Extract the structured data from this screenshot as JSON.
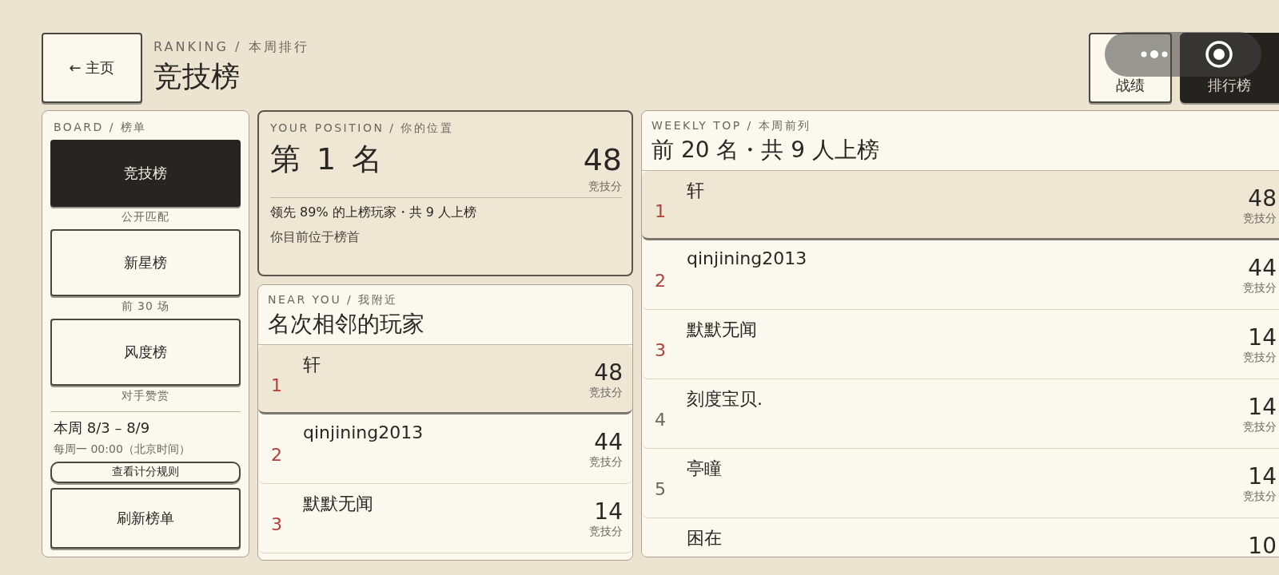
{
  "header": {
    "back_button": "← 主页",
    "eyebrow": "RANKING / 本周排行",
    "title": "竞技榜",
    "tabs": [
      {
        "label": "战绩",
        "selected": false
      },
      {
        "label": "排行榜",
        "selected": true
      }
    ]
  },
  "board": {
    "heading": "BOARD / 榜单",
    "items": [
      {
        "label": "竞技榜",
        "sub": "公开匹配",
        "selected": true
      },
      {
        "label": "新星榜",
        "sub": "前 30 场",
        "selected": false
      },
      {
        "label": "风度榜",
        "sub": "对手赞赏",
        "selected": false
      }
    ],
    "week": "本周 8/3 – 8/9",
    "reset": "每周一 00:00（北京时间）",
    "rules_button": "查看计分规则",
    "refresh_button": "刷新榜单"
  },
  "position": {
    "heading": "YOUR POSITION / 你的位置",
    "rank": "第 1 名",
    "score": "48",
    "score_label": "竞技分",
    "lead": "领先 89% 的上榜玩家・共 9 人上榜",
    "note": "你目前位于榜首"
  },
  "near": {
    "heading": "NEAR YOU / 我附近",
    "title": "名次相邻的玩家",
    "rows": [
      {
        "rank": "1",
        "name": "轩",
        "score": "48",
        "score_label": "竞技分",
        "selected": true,
        "podium": true
      },
      {
        "rank": "2",
        "name": "qinjining2013",
        "score": "44",
        "score_label": "竞技分",
        "selected": false,
        "podium": true
      },
      {
        "rank": "3",
        "name": "默默无闻",
        "score": "14",
        "score_label": "竞技分",
        "selected": false,
        "podium": true
      }
    ]
  },
  "weekly": {
    "heading": "WEEKLY TOP / 本周前列",
    "title": "前 20 名・共 9 人上榜",
    "rows": [
      {
        "rank": "1",
        "name": "轩",
        "score": "48",
        "score_label": "竞技分",
        "selected": true,
        "podium": true
      },
      {
        "rank": "2",
        "name": "qinjining2013",
        "score": "44",
        "score_label": "竞技分",
        "selected": false,
        "podium": true
      },
      {
        "rank": "3",
        "name": "默默无闻",
        "score": "14",
        "score_label": "竞技分",
        "selected": false,
        "podium": true
      },
      {
        "rank": "4",
        "name": "刻度宝贝.",
        "score": "14",
        "score_label": "竞技分",
        "selected": false,
        "podium": false
      },
      {
        "rank": "5",
        "name": "亭瞳",
        "score": "14",
        "score_label": "竞技分",
        "selected": false,
        "podium": false
      },
      {
        "name": "困在",
        "score": "10",
        "selected": false
      }
    ]
  }
}
